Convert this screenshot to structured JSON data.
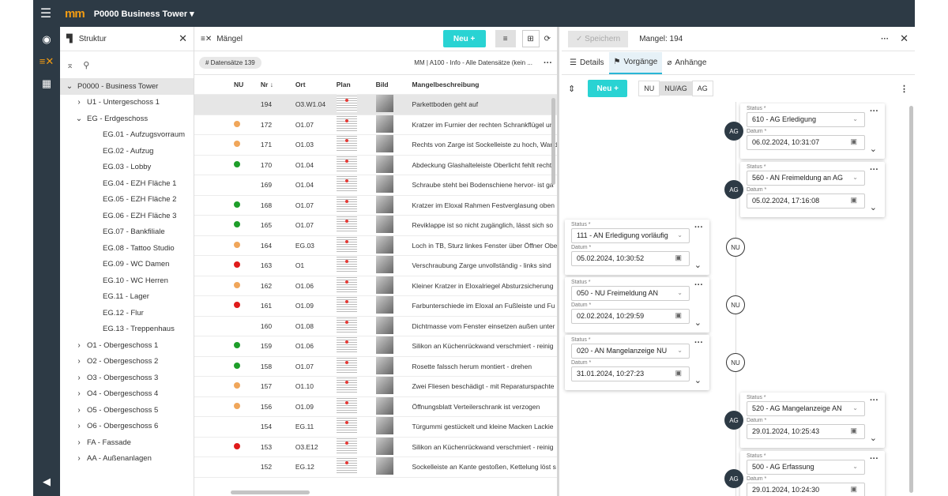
{
  "app": {
    "project": "P0000 Business Tower",
    "logo": "mm"
  },
  "tree_panel": {
    "title": "Struktur",
    "nodes": [
      {
        "label": "P0000 - Business Tower",
        "level": 0,
        "chev": "⌄",
        "sel": true
      },
      {
        "label": "U1 - Untergeschoss 1",
        "level": 1,
        "chev": "›"
      },
      {
        "label": "EG - Erdgeschoss",
        "level": 1,
        "chev": "⌄"
      },
      {
        "label": "EG.01 - Aufzugsvorraum",
        "level": 2
      },
      {
        "label": "EG.02 - Aufzug",
        "level": 2
      },
      {
        "label": "EG.03 - Lobby",
        "level": 2
      },
      {
        "label": "EG.04 - EZH Fläche 1",
        "level": 2
      },
      {
        "label": "EG.05 - EZH Fläche 2",
        "level": 2
      },
      {
        "label": "EG.06 - EZH Fläche 3",
        "level": 2
      },
      {
        "label": "EG.07 - Bankfiliale",
        "level": 2
      },
      {
        "label": "EG.08 - Tattoo Studio",
        "level": 2
      },
      {
        "label": "EG.09 - WC Damen",
        "level": 2
      },
      {
        "label": "EG.10 - WC Herren",
        "level": 2
      },
      {
        "label": "EG.11 - Lager",
        "level": 2
      },
      {
        "label": "EG.12 - Flur",
        "level": 2
      },
      {
        "label": "EG.13 - Treppenhaus",
        "level": 2
      },
      {
        "label": "O1 - Obergeschoss 1",
        "level": 1,
        "chev": "›"
      },
      {
        "label": "O2 - Obergeschoss 2",
        "level": 1,
        "chev": "›"
      },
      {
        "label": "O3 - Obergeschoss 3",
        "level": 1,
        "chev": "›"
      },
      {
        "label": "O4 - Obergeschoss 4",
        "level": 1,
        "chev": "›"
      },
      {
        "label": "O5 - Obergeschoss 5",
        "level": 1,
        "chev": "›"
      },
      {
        "label": "O6 - Obergeschoss 6",
        "level": 1,
        "chev": "›"
      },
      {
        "label": "FA - Fassade",
        "level": 1,
        "chev": "›"
      },
      {
        "label": "AA - Außenanlagen",
        "level": 1,
        "chev": "›"
      }
    ]
  },
  "list_panel": {
    "title": "Mängel",
    "new_label": "Neu",
    "count_badge": "# Datensätze 139",
    "filter_text": "MM | A100 - Info - Alle Datensätze (kein ...",
    "columns": {
      "nu": "NU",
      "nr": "Nr",
      "ort": "Ort",
      "plan": "Plan",
      "bild": "Bild",
      "desc": "Mangelbeschreibung"
    },
    "rows": [
      {
        "nr": "194",
        "ort": "O3.W1.04",
        "dot": "",
        "desc": "Parkettboden geht auf",
        "sel": true
      },
      {
        "nr": "172",
        "ort": "O1.07",
        "dot": "#f0a65a",
        "desc": "Kratzer im Furnier der rechten Schrankflügel un"
      },
      {
        "nr": "171",
        "ort": "O1.03",
        "dot": "#f0a65a",
        "desc": "Rechts von Zarge ist Sockelleiste zu hoch, Wand"
      },
      {
        "nr": "170",
        "ort": "O1.04",
        "dot": "#1e9e2a",
        "desc": "Abdeckung Glashalteleiste Oberlicht fehlt recht"
      },
      {
        "nr": "169",
        "ort": "O1.04",
        "dot": "",
        "desc": "Schraube steht bei Bodenschiene hervor- ist ga"
      },
      {
        "nr": "168",
        "ort": "O1.07",
        "dot": "#1e9e2a",
        "desc": "Kratzer im Eloxal Rahmen Festverglasung oben"
      },
      {
        "nr": "165",
        "ort": "O1.07",
        "dot": "#1e9e2a",
        "desc": "Reviklappe ist so nicht zugänglich, lässt sich so"
      },
      {
        "nr": "164",
        "ort": "EG.03",
        "dot": "#f0a65a",
        "desc": "Loch in TB, Sturz linkes Fenster über Öffner Obe"
      },
      {
        "nr": "163",
        "ort": "O1",
        "dot": "#e01b1b",
        "desc": "Verschraubung Zarge unvollständig - links sind"
      },
      {
        "nr": "162",
        "ort": "O1.06",
        "dot": "#f0a65a",
        "desc": "Kleiner Kratzer in Eloxalriegel Absturzsicherung"
      },
      {
        "nr": "161",
        "ort": "O1.09",
        "dot": "#e01b1b",
        "desc": "Farbunterschiede im Eloxal an Fußleiste und Fu"
      },
      {
        "nr": "160",
        "ort": "O1.08",
        "dot": "",
        "desc": "Dichtmasse vom Fenster einsetzen außen unter"
      },
      {
        "nr": "159",
        "ort": "O1.06",
        "dot": "#1e9e2a",
        "desc": "Silikon an Küchenrückwand verschmiert - reinig"
      },
      {
        "nr": "158",
        "ort": "O1.07",
        "dot": "#1e9e2a",
        "desc": "Rosette falssch herum montiert - drehen"
      },
      {
        "nr": "157",
        "ort": "O1.10",
        "dot": "#f0a65a",
        "desc": "Zwei Fliesen beschädigt - mit Reparaturspachte"
      },
      {
        "nr": "156",
        "ort": "O1.09",
        "dot": "#f0a65a",
        "desc": "Öffnungsblatt Verteilerschrank ist verzogen"
      },
      {
        "nr": "154",
        "ort": "EG.11",
        "dot": "",
        "desc": "Türgummi gestückelt und kleine Macken Lackie"
      },
      {
        "nr": "153",
        "ort": "O3.E12",
        "dot": "#e01b1b",
        "desc": "Silikon an Küchenrückwand verschmiert - reinig"
      },
      {
        "nr": "152",
        "ort": "EG.12",
        "dot": "",
        "desc": "Sockelleiste an Kante gestoßen, Kettelung löst s"
      }
    ]
  },
  "detail": {
    "save_label": "Speichern",
    "title": "Mangel: 194",
    "tabs": {
      "details": "Details",
      "vorgaenge": "Vorgänge",
      "anhaenge": "Anhänge"
    },
    "new_label": "Neu",
    "filters": {
      "nu": "NU",
      "nuag": "NU/AG",
      "ag": "AG"
    },
    "status_label": "Status *",
    "date_label": "Datum *",
    "entries": [
      {
        "side": "ag",
        "who": "AG",
        "status": "610 - AG Erledigung",
        "date": "06.02.2024, 10:31:07"
      },
      {
        "side": "ag",
        "who": "AG",
        "status": "560 - AN Freimeldung an AG",
        "date": "05.02.2024, 17:16:08"
      },
      {
        "side": "nu",
        "who": "NU",
        "status": "111 - AN Erledigung vorläufig",
        "date": "05.02.2024, 10:30:52"
      },
      {
        "side": "nu",
        "who": "NU",
        "status": "050 - NU Freimeldung AN",
        "date": "02.02.2024, 10:29:59"
      },
      {
        "side": "nu",
        "who": "NU",
        "status": "020 - AN Mangelanzeige NU",
        "date": "31.01.2024, 10:27:23"
      },
      {
        "side": "ag",
        "who": "AG",
        "status": "520 - AG Mangelanzeige AN",
        "date": "29.01.2024, 10:25:43"
      },
      {
        "side": "ag",
        "who": "AG",
        "status": "500 - AG Erfassung",
        "date": "29.01.2024, 10:24:30"
      }
    ]
  }
}
